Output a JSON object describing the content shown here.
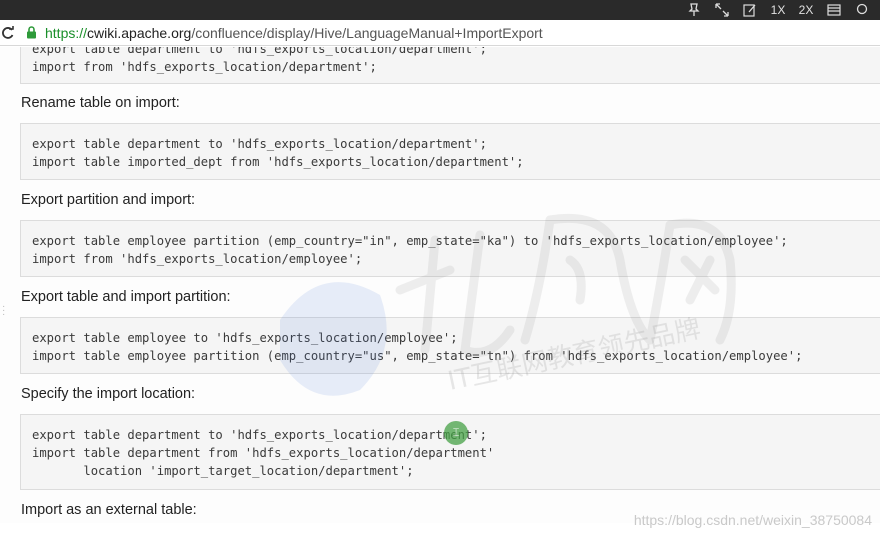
{
  "browser": {
    "toolbar": {
      "items": [
        {
          "icon": "pin-icon",
          "label": ""
        },
        {
          "icon": "expand-icon",
          "label": ""
        },
        {
          "icon": "edit-icon",
          "label": ""
        },
        {
          "icon": "",
          "label": "1X"
        },
        {
          "icon": "",
          "label": "2X"
        },
        {
          "icon": "list-icon",
          "label": ""
        },
        {
          "icon": "search-icon",
          "label": ""
        }
      ]
    },
    "url": {
      "scheme": "https://",
      "host": "cwiki.apache.org",
      "path": "/confluence/display/Hive/LanguageManual+ImportExport"
    }
  },
  "sections": [
    {
      "heading": "",
      "code": [
        "export table department to 'hdfs_exports_location/department';",
        "import from 'hdfs_exports_location/department';"
      ]
    },
    {
      "heading": "Rename table on import:",
      "code": [
        "export table department to 'hdfs_exports_location/department';",
        "import table imported_dept from 'hdfs_exports_location/department';"
      ]
    },
    {
      "heading": "Export partition and import:",
      "code": [
        "export table employee partition (emp_country=\"in\", emp_state=\"ka\") to 'hdfs_exports_location/employee';",
        "import from 'hdfs_exports_location/employee';"
      ]
    },
    {
      "heading": "Export table and import partition:",
      "code": [
        "export table employee to 'hdfs_exports_location/employee';",
        "import table employee partition (emp_country=\"us\", emp_state=\"tn\") from 'hdfs_exports_location/employee';"
      ]
    },
    {
      "heading": "Specify the import location:",
      "code": [
        "export table department to 'hdfs_exports_location/department';",
        "import table department from 'hdfs_exports_location/department'",
        "       location 'import_target_location/department';"
      ]
    },
    {
      "heading": "Import as an external table:",
      "code": []
    }
  ],
  "watermark": {
    "site": "https://blog.csdn.net/weixin_38750084",
    "logo_text_cn": "北风网",
    "logo_subtext": "IT互联网教育领先品牌"
  }
}
